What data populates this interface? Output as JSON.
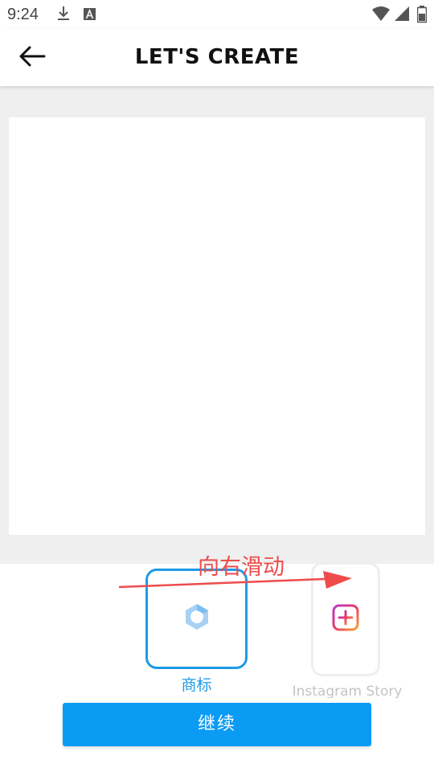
{
  "status_bar": {
    "time": "9:24",
    "left_icons": [
      "download-icon",
      "font-icon"
    ],
    "right_icons": [
      "wifi-icon",
      "signal-icon",
      "battery-icon"
    ]
  },
  "header": {
    "back_icon": "arrow-left-icon",
    "title": "LET'S CREATE"
  },
  "templates": {
    "items": [
      {
        "label": "商标",
        "icon": "logo-ring-icon",
        "selected": true
      },
      {
        "label": "Instagram Story",
        "icon": "instagram-add-icon",
        "selected": false
      }
    ]
  },
  "swipe_hint": {
    "text": "向右滑动",
    "color": "#ee4c4c"
  },
  "continue_button": {
    "label": "继续"
  },
  "colors": {
    "accent": "#1e9ae8",
    "button": "#0a9bf5",
    "canvas_bg": "#efefef"
  }
}
